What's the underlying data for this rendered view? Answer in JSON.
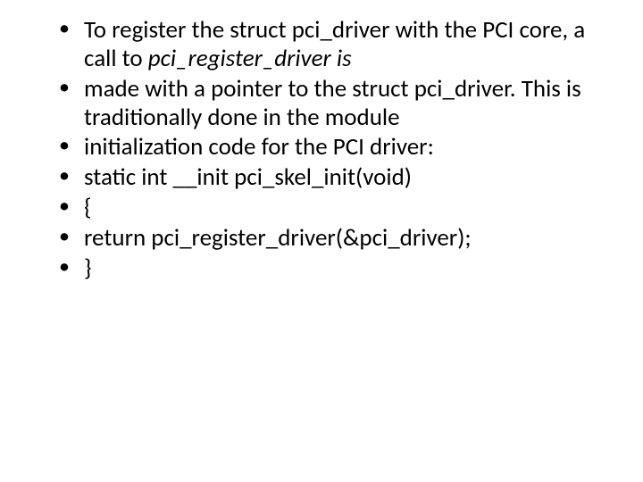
{
  "bullets": [
    {
      "pre": "To register the struct pci_driver with the PCI core, a call to ",
      "ital": "pci_register_driver is",
      "post": ""
    },
    {
      "pre": "made with a pointer to the struct pci_driver. This is traditionally done in the module",
      "ital": "",
      "post": ""
    },
    {
      "pre": "initialization code for the PCI driver:",
      "ital": "",
      "post": ""
    },
    {
      "pre": "static int __init pci_skel_init(void)",
      "ital": "",
      "post": ""
    },
    {
      "pre": "{",
      "ital": "",
      "post": ""
    },
    {
      "pre": "return pci_register_driver(&pci_driver);",
      "ital": "",
      "post": ""
    },
    {
      "pre": "}",
      "ital": "",
      "post": ""
    }
  ]
}
